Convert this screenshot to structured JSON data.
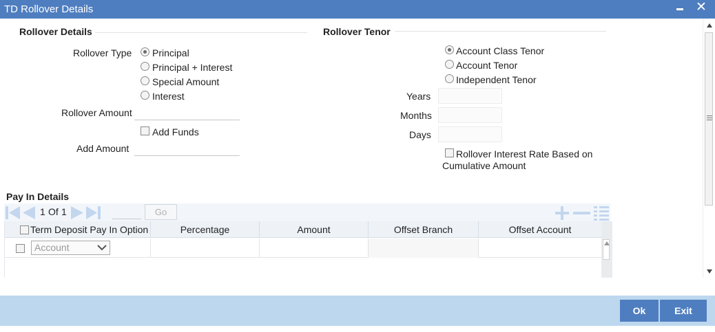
{
  "window": {
    "title": "TD Rollover Details"
  },
  "rollover_details": {
    "section_title": "Rollover Details",
    "rollover_type_label": "Rollover Type",
    "rollover_type_options": [
      {
        "label": "Principal",
        "selected": true
      },
      {
        "label": "Principal + Interest",
        "selected": false
      },
      {
        "label": "Special Amount",
        "selected": false
      },
      {
        "label": "Interest",
        "selected": false
      }
    ],
    "rollover_amount_label": "Rollover Amount",
    "rollover_amount_value": "",
    "add_funds_label": "Add Funds",
    "add_funds_checked": false,
    "add_amount_label": "Add Amount",
    "add_amount_value": ""
  },
  "rollover_tenor": {
    "section_title": "Rollover Tenor",
    "tenor_options": [
      {
        "label": "Account Class Tenor",
        "selected": true
      },
      {
        "label": "Account Tenor",
        "selected": false
      },
      {
        "label": "Independent Tenor",
        "selected": false
      }
    ],
    "years_label": "Years",
    "months_label": "Months",
    "days_label": "Days",
    "years_value": "",
    "months_value": "",
    "days_value": "",
    "interest_rate_check_label_line1": "Rollover Interest Rate Based on",
    "interest_rate_check_label_line2": "Cumulative Amount",
    "interest_rate_checked": false
  },
  "pay_in": {
    "section_title": "Pay In Details",
    "pager": {
      "current": "1",
      "of_label": "Of",
      "total": "1",
      "go_label": "Go"
    },
    "columns": [
      "Term Deposit Pay In Option",
      "Percentage",
      "Amount",
      "Offset Branch",
      "Offset Account"
    ],
    "rows": [
      {
        "option": "Account",
        "percentage": "",
        "amount": "",
        "offset_branch": "",
        "offset_account": ""
      }
    ]
  },
  "footer": {
    "ok_label": "Ok",
    "exit_label": "Exit"
  },
  "colors": {
    "title_bar": "#4f7ec0",
    "footer_bg": "#bdd7ef",
    "button": "#4f7ec0"
  }
}
